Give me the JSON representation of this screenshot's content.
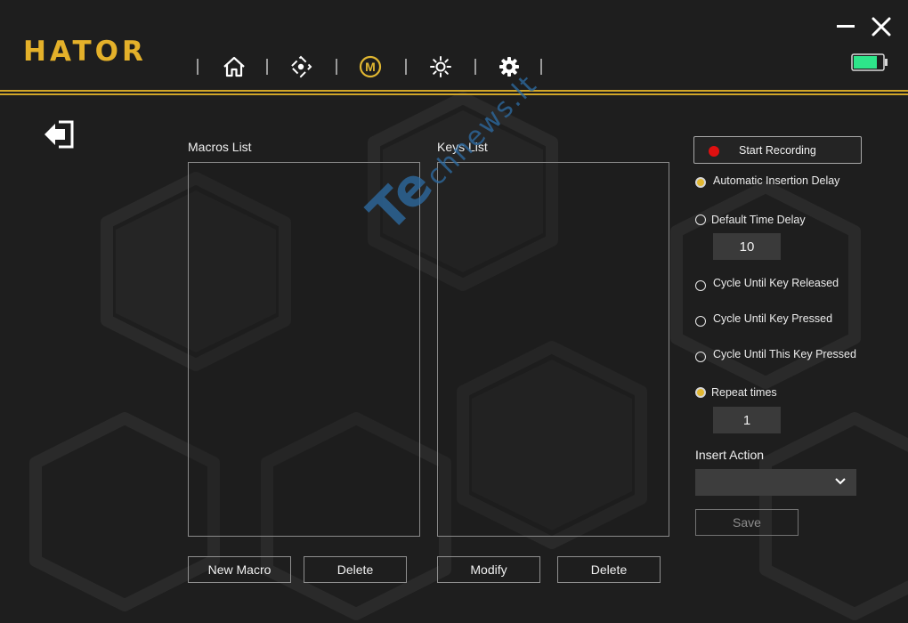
{
  "app": {
    "brand": "HATOR"
  },
  "nav": {
    "items": [
      {
        "icon": "home-icon"
      },
      {
        "icon": "dpad-icon"
      },
      {
        "icon": "macro-icon",
        "active": true
      },
      {
        "icon": "lighting-icon"
      },
      {
        "icon": "gear-icon"
      }
    ]
  },
  "window": {
    "minimize_icon": "minimize-icon",
    "close_icon": "close-icon",
    "battery_icon": "battery-icon"
  },
  "colors": {
    "accent": "#e1b731",
    "background": "#1e1e1e",
    "record": "#e01010",
    "battery": "#2ee58a"
  },
  "macros_list": {
    "label": "Macros List",
    "items": []
  },
  "keys_list": {
    "label": "Keys List",
    "items": []
  },
  "buttons": {
    "new_macro": "New Macro",
    "delete_macro": "Delete",
    "modify": "Modify",
    "delete_key": "Delete"
  },
  "recording": {
    "start_label": "Start Recording"
  },
  "options": {
    "automatic_insertion_delay": {
      "label": "Automatic Insertion Delay",
      "checked": true
    },
    "default_time_delay": {
      "label": "Default Time Delay",
      "checked": false,
      "value": "10"
    },
    "cycle_until_key_released": {
      "label": "Cycle Until Key Released",
      "checked": false
    },
    "cycle_until_key_pressed": {
      "label": "Cycle Until Key Pressed",
      "checked": false
    },
    "cycle_until_this_key_pressed": {
      "label": "Cycle Until This Key Pressed",
      "checked": false
    },
    "repeat_times": {
      "label": "Repeat times",
      "checked": true,
      "value": "1"
    }
  },
  "insert_action": {
    "label": "Insert Action",
    "selected": ""
  },
  "save": {
    "label": "Save"
  },
  "watermark": {
    "te": "Te",
    "rest": "chnews.lt"
  }
}
